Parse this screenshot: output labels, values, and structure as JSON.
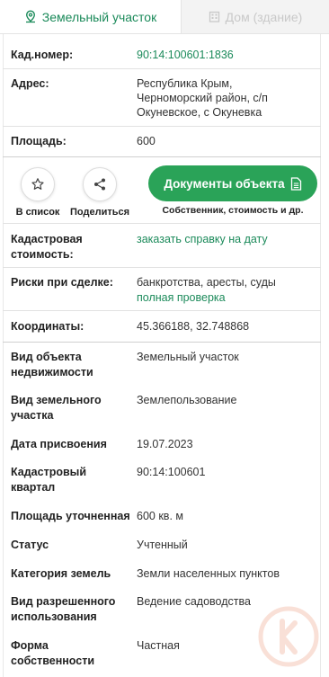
{
  "tabs": [
    {
      "label": "Земельный участок",
      "active": true,
      "icon": "map-pin-icon"
    },
    {
      "label": "Дом (здание)",
      "active": false,
      "icon": "building-icon"
    }
  ],
  "main": {
    "cad_number": {
      "label": "Кад.номер:",
      "value": "90:14:100601:1836"
    },
    "address": {
      "label": "Адрес:",
      "lines": [
        "Республика Крым,",
        "Черноморский район, с/п",
        "Окуневское, с Окуневка"
      ]
    },
    "area": {
      "label": "Площадь:",
      "value": "600"
    }
  },
  "actions": {
    "favorite_label": "В список",
    "share_label": "Поделиться",
    "documents_button": "Документы объекта",
    "documents_sub": "Собственник, стоимость и др."
  },
  "details": {
    "cad_value": {
      "label_lines": [
        "Кадастровая",
        "стоимость:"
      ],
      "link": "заказать справку на дату"
    },
    "risks": {
      "label": "Риски при сделке:",
      "value": "банкротства, аресты, суды",
      "link": "полная проверка"
    },
    "coords": {
      "label": "Координаты:",
      "value": "45.366188, 32.748868"
    }
  },
  "props": [
    {
      "label_lines": [
        "Вид объекта",
        "недвижимости"
      ],
      "value": "Земельный участок"
    },
    {
      "label_lines": [
        "Вид земельного",
        "участка"
      ],
      "value": "Землепользование"
    },
    {
      "label_lines": [
        "Дата присвоения"
      ],
      "value": "19.07.2023"
    },
    {
      "label_lines": [
        "Кадастровый",
        "квартал"
      ],
      "value": "90:14:100601"
    },
    {
      "label_lines": [
        "Площадь уточненная"
      ],
      "value": "600 кв. м"
    },
    {
      "label_lines": [
        "Статус"
      ],
      "value": "Учтенный"
    },
    {
      "label_lines": [
        "Категория земель"
      ],
      "value": "Земли населенных пунктов"
    },
    {
      "label_lines": [
        "Вид разрешенного",
        "использования"
      ],
      "value": "Ведение садоводства"
    },
    {
      "label_lines": [
        "Форма",
        "собственности"
      ],
      "value": "Частная"
    }
  ],
  "colors": {
    "accent": "#1b8a5a",
    "button": "#2aa358"
  }
}
